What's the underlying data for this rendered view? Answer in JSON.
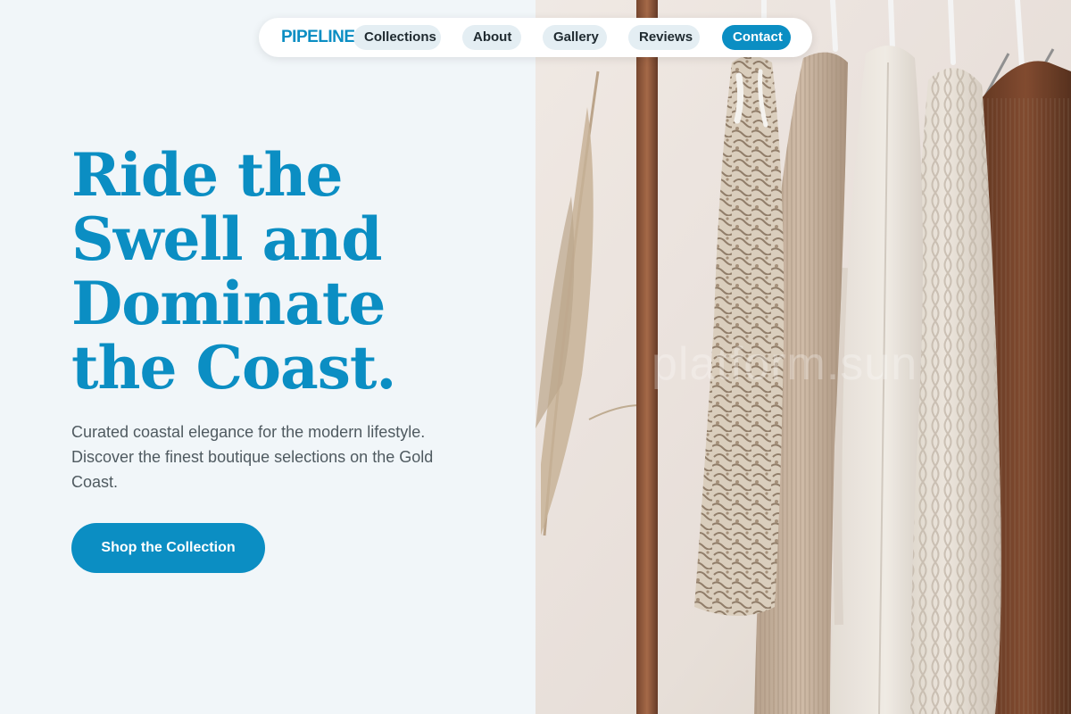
{
  "colors": {
    "accent": "#0b8ec3",
    "background": "#f1f6f9",
    "nav_pill": "#e4eef3",
    "body_text": "#4f5a60"
  },
  "nav": {
    "brand": "PIPELINE",
    "links": [
      {
        "label": "Collections"
      },
      {
        "label": "About"
      },
      {
        "label": "Gallery"
      },
      {
        "label": "Reviews"
      }
    ],
    "contact_label": "Contact"
  },
  "hero": {
    "title_lines": [
      "Ride the",
      "Swell and",
      "Dominate",
      "the Coast."
    ],
    "subtitle": "Curated coastal elegance for the modern lifestyle. Discover the finest boutique selections on the Gold Coast.",
    "cta_label": "Shop the Collection"
  },
  "image": {
    "subject": "clothing-rack",
    "watermark": "platform.sun"
  }
}
